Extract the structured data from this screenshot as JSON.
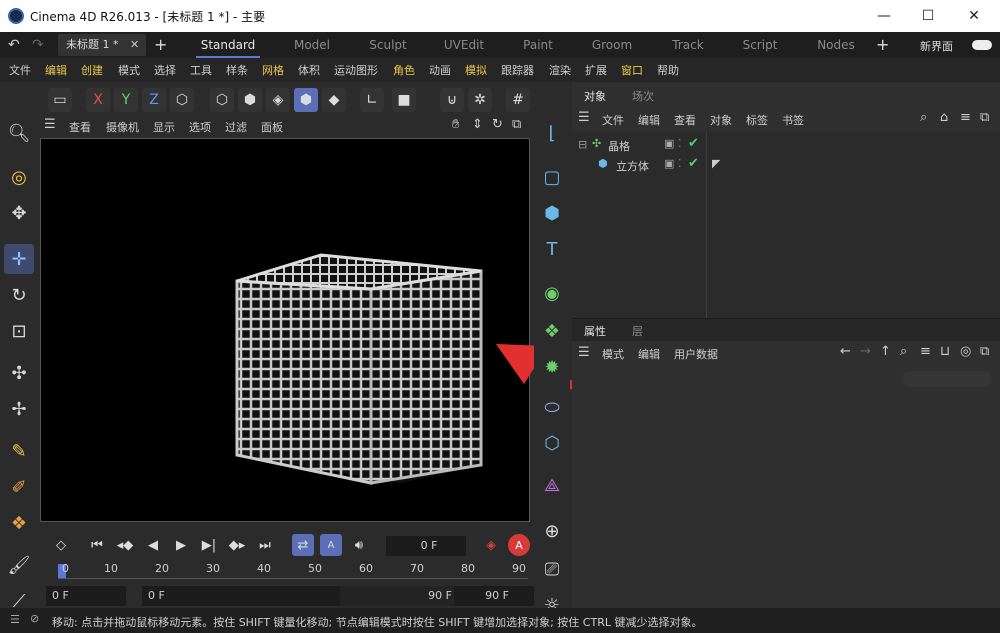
{
  "window": {
    "title": "Cinema 4D R26.013 - [未标题 1 *] - 主要"
  },
  "tabs": {
    "doc_tab": "未标题 1 *",
    "layouts": [
      "Standard",
      "Model",
      "Sculpt",
      "UVEdit",
      "Paint",
      "Groom",
      "Track",
      "Script",
      "Nodes"
    ],
    "new_ui_label": "新界面"
  },
  "menubar": [
    "文件",
    "编辑",
    "创建",
    "模式",
    "选择",
    "工具",
    "样条",
    "网格",
    "体积",
    "运动图形",
    "角色",
    "动画",
    "模拟",
    "跟踪器",
    "渲染",
    "扩展",
    "窗口",
    "帮助"
  ],
  "toolbar": {
    "axis_labels": [
      "X",
      "Y",
      "Z"
    ]
  },
  "viewport_menu": [
    "查看",
    "摄像机",
    "显示",
    "选项",
    "过滤",
    "面板"
  ],
  "object_manager": {
    "tabs": [
      "对象",
      "场次"
    ],
    "menu": [
      "文件",
      "编辑",
      "查看",
      "对象",
      "标签",
      "书签"
    ],
    "items": [
      {
        "name": "晶格",
        "level": 0
      },
      {
        "name": "立方体",
        "level": 1
      }
    ]
  },
  "attribute_manager": {
    "tabs": [
      "属性",
      "层"
    ],
    "menu": [
      "模式",
      "编辑",
      "用户数据"
    ]
  },
  "timeline": {
    "current_frame": "0 F",
    "ticks": [
      "0",
      "10",
      "20",
      "30",
      "40",
      "50",
      "60",
      "70",
      "80",
      "90"
    ],
    "start_frame": "0 F",
    "preview_start": "0 F",
    "preview_end": "90 F",
    "end_frame": "90 F"
  },
  "status": {
    "message": "移动: 点击并拖动鼠标移动元素。按住 SHIFT 键量化移动; 节点编辑模式时按住 SHIFT 键增加选择对象; 按住 CTRL 键减少选择对象。"
  },
  "colors": {
    "accent": "#5a78d8",
    "arrow": "#e23030",
    "check": "#4fd06a"
  }
}
